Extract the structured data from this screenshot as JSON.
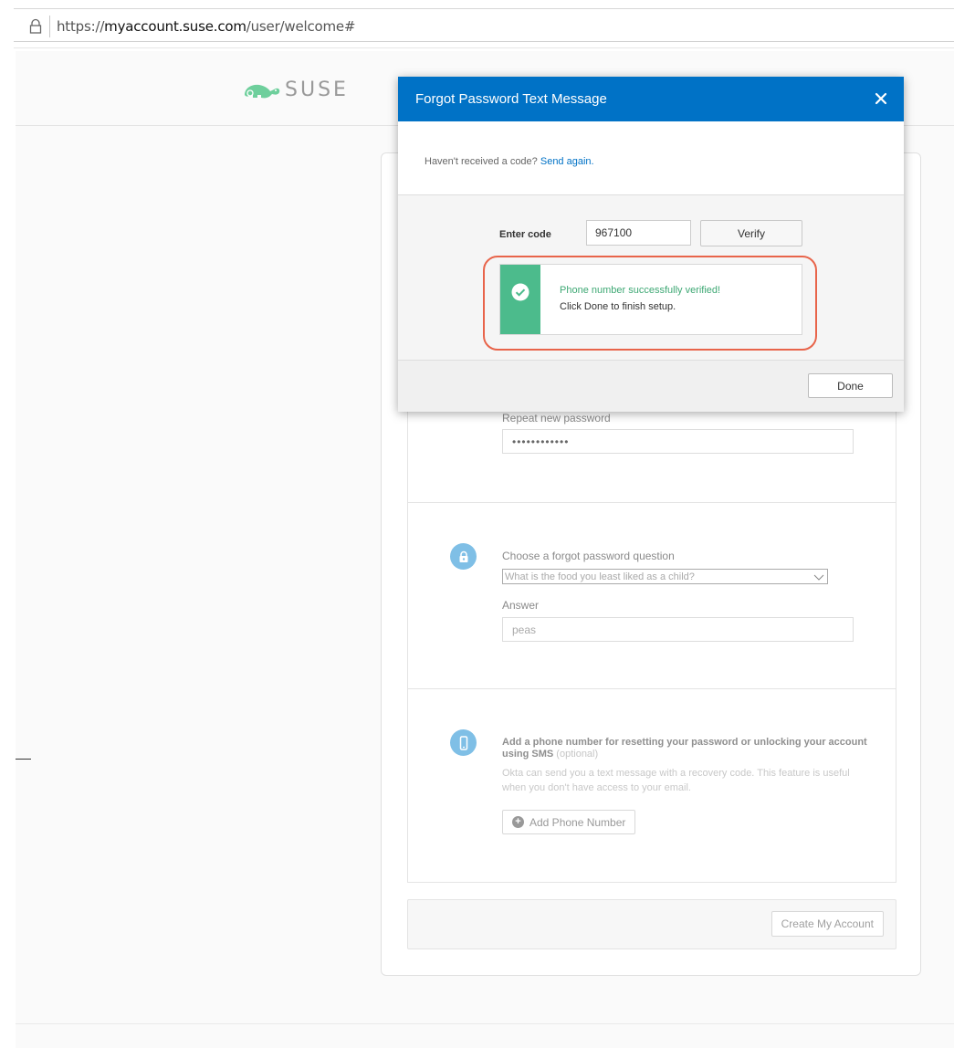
{
  "browser": {
    "url_prefix": "https://",
    "url_domain": "myaccount.suse.com",
    "url_path": "/user/welcome#"
  },
  "header": {
    "logo_text": "SUSE"
  },
  "form": {
    "repeat_password_label": "Repeat new password",
    "repeat_password_value": "••••••••••••",
    "question_label": "Choose a forgot password question",
    "question_selected": "What is the food you least liked as a child?",
    "answer_label": "Answer",
    "answer_value": "peas",
    "sms_title": "Add a phone number for resetting your password or unlocking your account using SMS",
    "sms_optional": "(optional)",
    "sms_desc": "Okta can send you a text message with a recovery code. This feature is useful when you don't have access to your email.",
    "add_phone_label": "Add Phone Number",
    "create_account_label": "Create My Account"
  },
  "modal": {
    "title": "Forgot Password Text Message",
    "no_code_text": "Haven't received a code?",
    "send_again_link": "Send again.",
    "enter_code_label": "Enter code",
    "code_value": "967100",
    "verify_label": "Verify",
    "success_title": "Phone number successfully verified!",
    "success_sub": "Click Done to finish setup.",
    "done_label": "Done"
  },
  "colors": {
    "modal_header": "#0072c6",
    "success_green": "#4cbb8c",
    "highlight": "#e8644a",
    "icon_blue": "#7fbfe6"
  },
  "icons": [
    "lock-icon",
    "suse-chameleon-icon",
    "close-icon",
    "check-icon",
    "padlock-icon",
    "phone-icon",
    "plus-icon",
    "chevron-down-icon"
  ]
}
